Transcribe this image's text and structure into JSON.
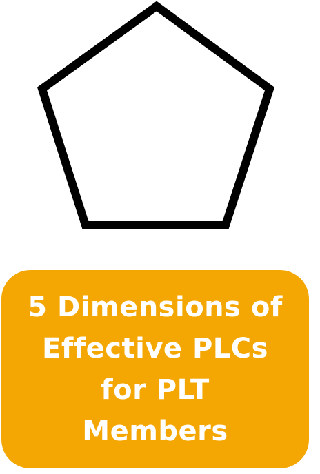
{
  "shape": {
    "kind": "pentagon",
    "stroke_color": "#000000",
    "fill_color": "#ffffff"
  },
  "title_box": {
    "background_color": "#f4a703",
    "text_color": "#ffffff",
    "lines": [
      "5 Dimensions of",
      "Effective PLCs",
      "for PLT",
      "Members"
    ]
  }
}
